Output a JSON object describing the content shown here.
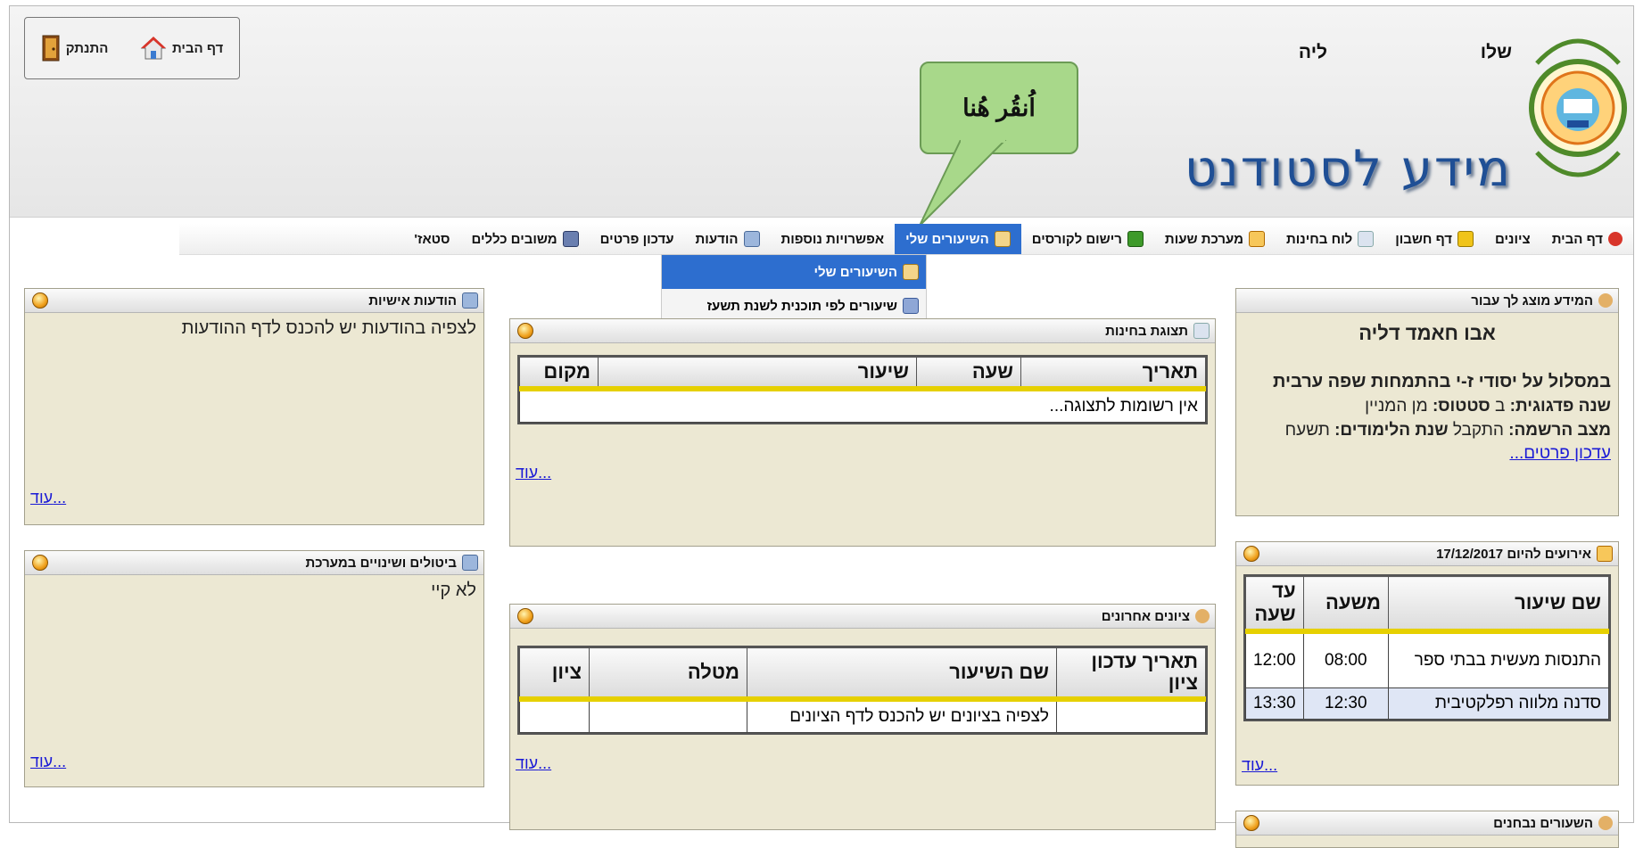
{
  "header": {
    "greeting_start": "שלו",
    "greeting_end": "ליה",
    "title": "מידע לסטודנט",
    "logout_label": "התנתק",
    "home_label": "דף הבית"
  },
  "callout": {
    "text": "اُنقُر هُنا"
  },
  "nav": {
    "items": [
      {
        "label": "דף הבית"
      },
      {
        "label": "ציונים"
      },
      {
        "label": "דף חשבון"
      },
      {
        "label": "לוח בחינות"
      },
      {
        "label": "מערכת שעות"
      },
      {
        "label": "רישום לקורסים"
      },
      {
        "label": "השיעורים שלי"
      },
      {
        "label": "אפשרויות נוספות"
      },
      {
        "label": "הודעות"
      },
      {
        "label": "עדכון פרטים"
      },
      {
        "label": "משובים כללים"
      },
      {
        "label": "סטאז'"
      }
    ],
    "dropdown": [
      {
        "label": "השיעורים שלי"
      },
      {
        "label": "שיעורים לפי תוכנית לשנת תשעז"
      }
    ]
  },
  "panel_info": {
    "title": "המידע מוצג לך עבור",
    "name": "אבו חאמד דליה",
    "track_label": "במסלול על יסודי ז-י בהתמחות שפה ערבית",
    "ped_year_label": "שנה פדגוגית:",
    "ped_year_value": "ב",
    "status_label": "סטטוס:",
    "status_value": "מן המניין",
    "reg_label": "מצב הרשמה:",
    "reg_value": "התקבל",
    "study_year_label": "שנת הלימודים:",
    "study_year_value": "תשעח",
    "update_link": "עדכון פרטים..."
  },
  "panel_events": {
    "title": "אירועים להיום 17/12/2017",
    "headers": [
      "שם שיעור",
      "משעה",
      "עד שעה"
    ],
    "rows": [
      {
        "name": "התנסות מעשית בבתי ספר",
        "from": "08:00",
        "to": "12:00"
      },
      {
        "name": "סדנה מלווה רפלקטיבית",
        "from": "12:30",
        "to": "13:30"
      }
    ],
    "more": "עוד..."
  },
  "panel_bottom_right": {
    "title": "השעורים נבחנים"
  },
  "panel_exams": {
    "title": "תצוגת בחינות",
    "headers": [
      "תאריך",
      "שעה",
      "שיעור",
      "מקום"
    ],
    "empty": "אין רשומות לתצוגה...",
    "more": "עוד..."
  },
  "panel_grades": {
    "title": "ציונים אחרונים",
    "headers": [
      "תאריך עדכון ציון",
      "שם השיעור",
      "מטלה",
      "ציון"
    ],
    "row_text": "לצפיה בציונים יש להכנס לדף הציונים",
    "more": "עוד..."
  },
  "panel_messages": {
    "title": "הודעות אישיות",
    "text": "לצפיה בהודעות יש להכנס לדף ההודעות",
    "more": "עוד..."
  },
  "panel_cancel": {
    "title": "ביטולים ושינויים במערכת",
    "text": "לא קיי",
    "more": "עוד..."
  }
}
